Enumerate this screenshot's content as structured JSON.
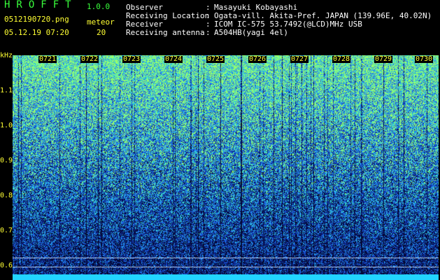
{
  "header": {
    "brand": "HROFFT",
    "version": "1.0.0",
    "filename": "0512190720.png",
    "datetime": "05.12.19 07:20",
    "meteor_label": "meteor",
    "meteor_count": "20",
    "info": [
      {
        "label": "Observer",
        "value": "Masayuki Kobayashi"
      },
      {
        "label": "Receiving Location",
        "value": "Ogata-vill. Akita-Pref. JAPAN (139.96E, 40.02N)"
      },
      {
        "label": "Receiver",
        "value": "ICOM IC-575 53.7492(@LCD)MHz USB"
      },
      {
        "label": "Receiving antenna",
        "value": "A504HB(yagi 4el)"
      }
    ]
  },
  "spectrogram": {
    "unit": "kHz",
    "y_ticks": [
      "1.1",
      "1.0",
      "0.9",
      "0.8",
      "0.7",
      "0.6"
    ],
    "x_ticks": [
      "0721",
      "0722",
      "0723",
      "0724",
      "0725",
      "0726",
      "0727",
      "0728",
      "0729",
      "0730"
    ],
    "colors": {
      "bg": "#020428",
      "low": "#0d1f7a",
      "mid": "#1f6ff0",
      "high": "#3af0c0",
      "peak": "#9bff5a"
    }
  }
}
